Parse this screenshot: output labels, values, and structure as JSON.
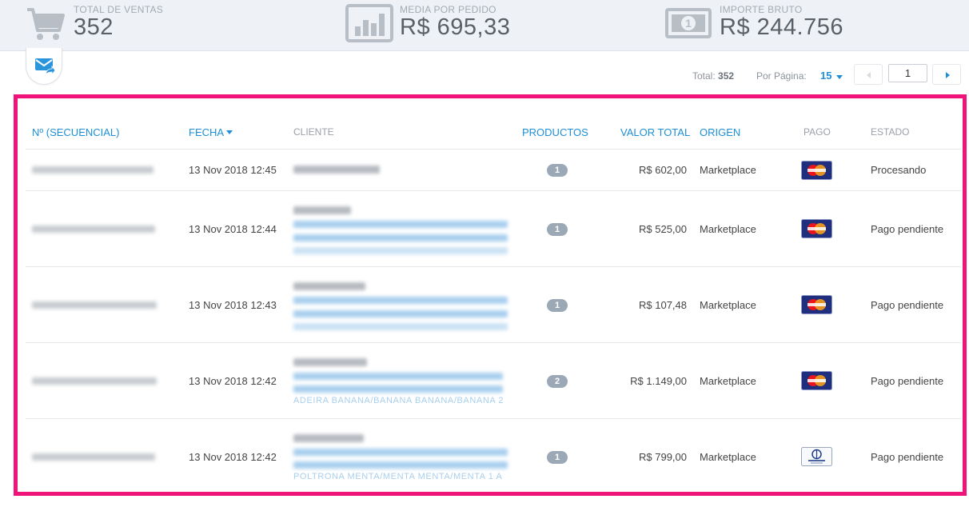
{
  "stats": [
    {
      "label": "TOTAL DE VENTAS",
      "value": "352",
      "icon": "cart-icon"
    },
    {
      "label": "MEDIA POR PEDIDO",
      "value": "R$ 695,33",
      "icon": "bar-chart-icon"
    },
    {
      "label": "IMPORTE BRUTO",
      "value": "R$ 244.756",
      "icon": "banknote-icon"
    }
  ],
  "toolbar": {
    "mail_icon": "mail-forward-icon"
  },
  "pagination": {
    "total_label": "Total:",
    "total_value": "352",
    "per_page_label": "Por Página:",
    "per_page_value": "15",
    "page_input": "1"
  },
  "table": {
    "headers": {
      "id": "Nº (SECUENCIAL)",
      "date": "FECHA",
      "client": "CLIENTE",
      "products": "PRODUCTOS",
      "total": "VALOR TOTAL",
      "origin": "ORIGEN",
      "payment": "PAGO",
      "status": "ESTADO"
    },
    "rows": [
      {
        "date": "13 Nov 2018 12:45",
        "products": "1",
        "total": "R$ 602,00",
        "origin": "Marketplace",
        "payment": "mastercard-icon",
        "status": "Procesando",
        "product_tail": ""
      },
      {
        "date": "13 Nov 2018 12:44",
        "products": "1",
        "total": "R$ 525,00",
        "origin": "Marketplace",
        "payment": "mastercard-icon",
        "status": "Pago pendiente",
        "product_tail": ""
      },
      {
        "date": "13 Nov 2018 12:43",
        "products": "1",
        "total": "R$ 107,48",
        "origin": "Marketplace",
        "payment": "mastercard-icon",
        "status": "Pago pendiente",
        "product_tail": ""
      },
      {
        "date": "13 Nov 2018 12:42",
        "products": "2",
        "total": "R$ 1.149,00",
        "origin": "Marketplace",
        "payment": "mastercard-icon",
        "status": "Pago pendiente",
        "product_tail": "ADEIRA BANANA/BANANA BANANA/BANANA 2"
      },
      {
        "date": "13 Nov 2018 12:42",
        "products": "1",
        "total": "R$ 799,00",
        "origin": "Marketplace",
        "payment": "diners-club-icon",
        "status": "Pago pendiente",
        "product_tail": "POLTRONA MENTA/MENTA MENTA/MENTA 1 A"
      }
    ]
  },
  "colors": {
    "accent": "#1d8fd8",
    "highlight": "#f0137a",
    "badge": "#9ba8b6"
  }
}
